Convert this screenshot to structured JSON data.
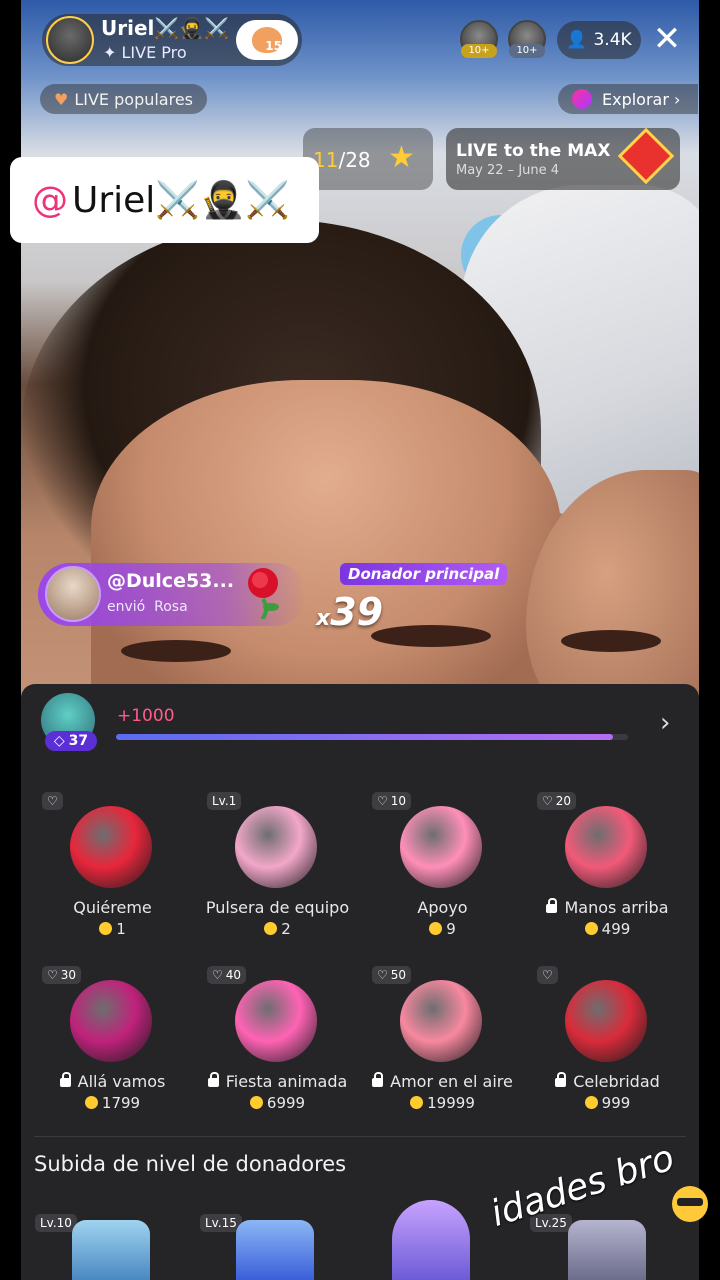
{
  "header": {
    "host_name": "Uriel⚔️🥷⚔️",
    "host_subtitle": "✦ LIVE Pro",
    "follow_heart_count": "15",
    "viewer_badges": [
      "10+",
      "10+"
    ],
    "viewer_count": "3.4K",
    "close_glyph": "✕"
  },
  "sub_header": {
    "popular_label": "LIVE populares",
    "explore_label": "Explorar ›"
  },
  "rank": {
    "current": "11",
    "total": "/28"
  },
  "event": {
    "title": "LIVE to the MAX",
    "dates": "May 22 – June 4"
  },
  "mention": {
    "at": "@",
    "name": "Uriel⚔️🥷⚔️"
  },
  "gift_notice": {
    "user": "@Dulce53...",
    "action": "envió",
    "gift": "Rosa",
    "badge": "Donador principal",
    "multiplier_prefix": "x",
    "multiplier": "39"
  },
  "panel": {
    "gem_count": "37",
    "progress_label": "+1000",
    "progress_fraction": 0.97,
    "gifts": [
      {
        "name": "Quiéreme",
        "price": "1",
        "tag": "",
        "locked": false,
        "color": "#e8263b"
      },
      {
        "name": "Pulsera de equipo",
        "price": "2",
        "tag": "Lv.1",
        "locked": false,
        "color": "#f3a7c9"
      },
      {
        "name": "Apoyo",
        "price": "9",
        "tag": "10",
        "locked": false,
        "color": "#ff8fb8"
      },
      {
        "name": "Manos arriba",
        "price": "499",
        "tag": "20",
        "locked": true,
        "color": "#f15a79"
      },
      {
        "name": "Allá vamos",
        "price": "1799",
        "tag": "30",
        "locked": true,
        "color": "#c0227b"
      },
      {
        "name": "Fiesta animada",
        "price": "6999",
        "tag": "40",
        "locked": true,
        "color": "#ff63b4"
      },
      {
        "name": "Amor en el aire",
        "price": "19999",
        "tag": "50",
        "locked": true,
        "color": "#f8889f"
      },
      {
        "name": "Celebridad",
        "price": "999",
        "tag": "",
        "locked": true,
        "color": "#d92b3a"
      }
    ],
    "section_title": "Subida de nivel de donadores",
    "level_items": [
      "Lv.10",
      "Lv.15",
      "",
      "Lv.25"
    ],
    "watermark": "idades bro"
  }
}
